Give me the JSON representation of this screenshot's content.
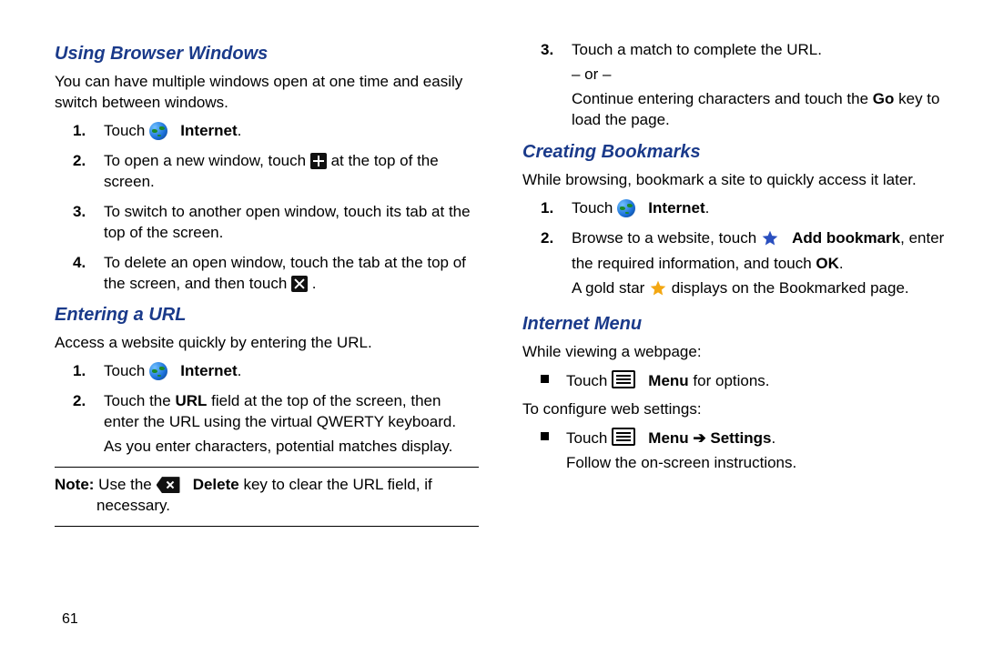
{
  "pageNumber": "61",
  "left": {
    "secA": {
      "title": "Using Browser Windows",
      "intro": "You can have multiple windows open at one time and easily switch between windows.",
      "step1_pre": "Touch ",
      "step1_bold": "Internet",
      "step1_post": ".",
      "step2_pre": "To open a new window, touch ",
      "step2_post": " at the top of the screen.",
      "step3": "To switch to another open window, touch its tab at the top of the screen.",
      "step4_pre": "To delete an open window, touch the tab at the top of the screen, and then touch ",
      "step4_post": "."
    },
    "secB": {
      "title": "Entering a URL",
      "intro": "Access a website quickly by entering the URL.",
      "step1_pre": "Touch ",
      "step1_bold": "Internet",
      "step1_post": ".",
      "step2_a": "Touch the ",
      "step2_url": "URL",
      "step2_b": " field at the top of the screen, then enter the URL using the virtual QWERTY keyboard.",
      "step2_sub": "As you enter characters, potential matches display.",
      "note_label": "Note:",
      "note_pre": " Use the ",
      "note_bold": "Delete",
      "note_post": " key to clear the URL field, if necessary."
    }
  },
  "right": {
    "secA_cont": {
      "step3_a": "Touch a match to complete the URL.",
      "step3_or": "– or –",
      "step3_b_pre": "Continue entering characters and touch the ",
      "step3_b_bold": "Go",
      "step3_b_post": " key to load the page."
    },
    "secC": {
      "title": "Creating Bookmarks",
      "intro": "While browsing, bookmark a site to quickly access it later.",
      "step1_pre": "Touch ",
      "step1_bold": "Internet",
      "step1_post": ".",
      "step2_pre": "Browse to a website, touch ",
      "step2_bold": "Add bookmark",
      "step2_mid": ", enter the required information, and touch ",
      "step2_ok": "OK",
      "step2_post": ".",
      "step2_after_pre": "A gold star ",
      "step2_after_post": " displays on the Bookmarked page."
    },
    "secD": {
      "title": "Internet Menu",
      "intro": "While viewing a webpage:",
      "b1_pre": "Touch ",
      "b1_bold": "Menu",
      "b1_post": " for options.",
      "mid": "To configure web settings:",
      "b2_pre": "Touch ",
      "b2_bold": "Menu",
      "b2_arrow": " ➔ ",
      "b2_bold2": "Settings",
      "b2_post": ".",
      "b2_sub": "Follow the on-screen instructions."
    }
  }
}
